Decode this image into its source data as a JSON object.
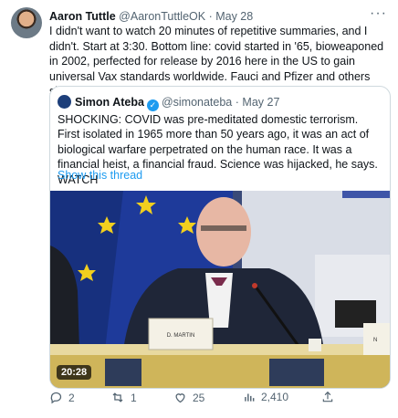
{
  "tweet": {
    "author_name": "Aaron Tuttle",
    "author_handle": "@AaronTuttleOK",
    "separator": "·",
    "date": "May 28",
    "more_icon": "more-dots-icon",
    "text": "I didn't want to watch 20 minutes of repetitive summaries, and I didn't. Start at 3:30. Bottom line: covid started in '65, bioweaponed in 2002, perfected for release by 2016 here in the US to gain universal Vax standards worldwide. Fauci and Pfizer and others should be hung."
  },
  "quote": {
    "author_name": "Simon Ateba",
    "author_handle": "@simonateba",
    "separator": "·",
    "date": "May 27",
    "text": "SHOCKING: COVID was pre-meditated domestic terrorism. First isolated in 1965 more than 50 years ago, it was an act of biological warfare perpetrated on the human race. It was a financial heist, a financial fraud. Science was hijacked, he says. WATCH",
    "show_thread": "Show this thread",
    "video": {
      "duration": "20:28",
      "nameplate": "D. MARTIN",
      "side_plate": "N"
    }
  },
  "actions": {
    "reply_count": "2",
    "retweet_count": "1",
    "like_count": "25",
    "views_count": "2,410"
  },
  "colors": {
    "link": "#1d9bf0",
    "muted": "#536471",
    "text": "#0f1419"
  }
}
